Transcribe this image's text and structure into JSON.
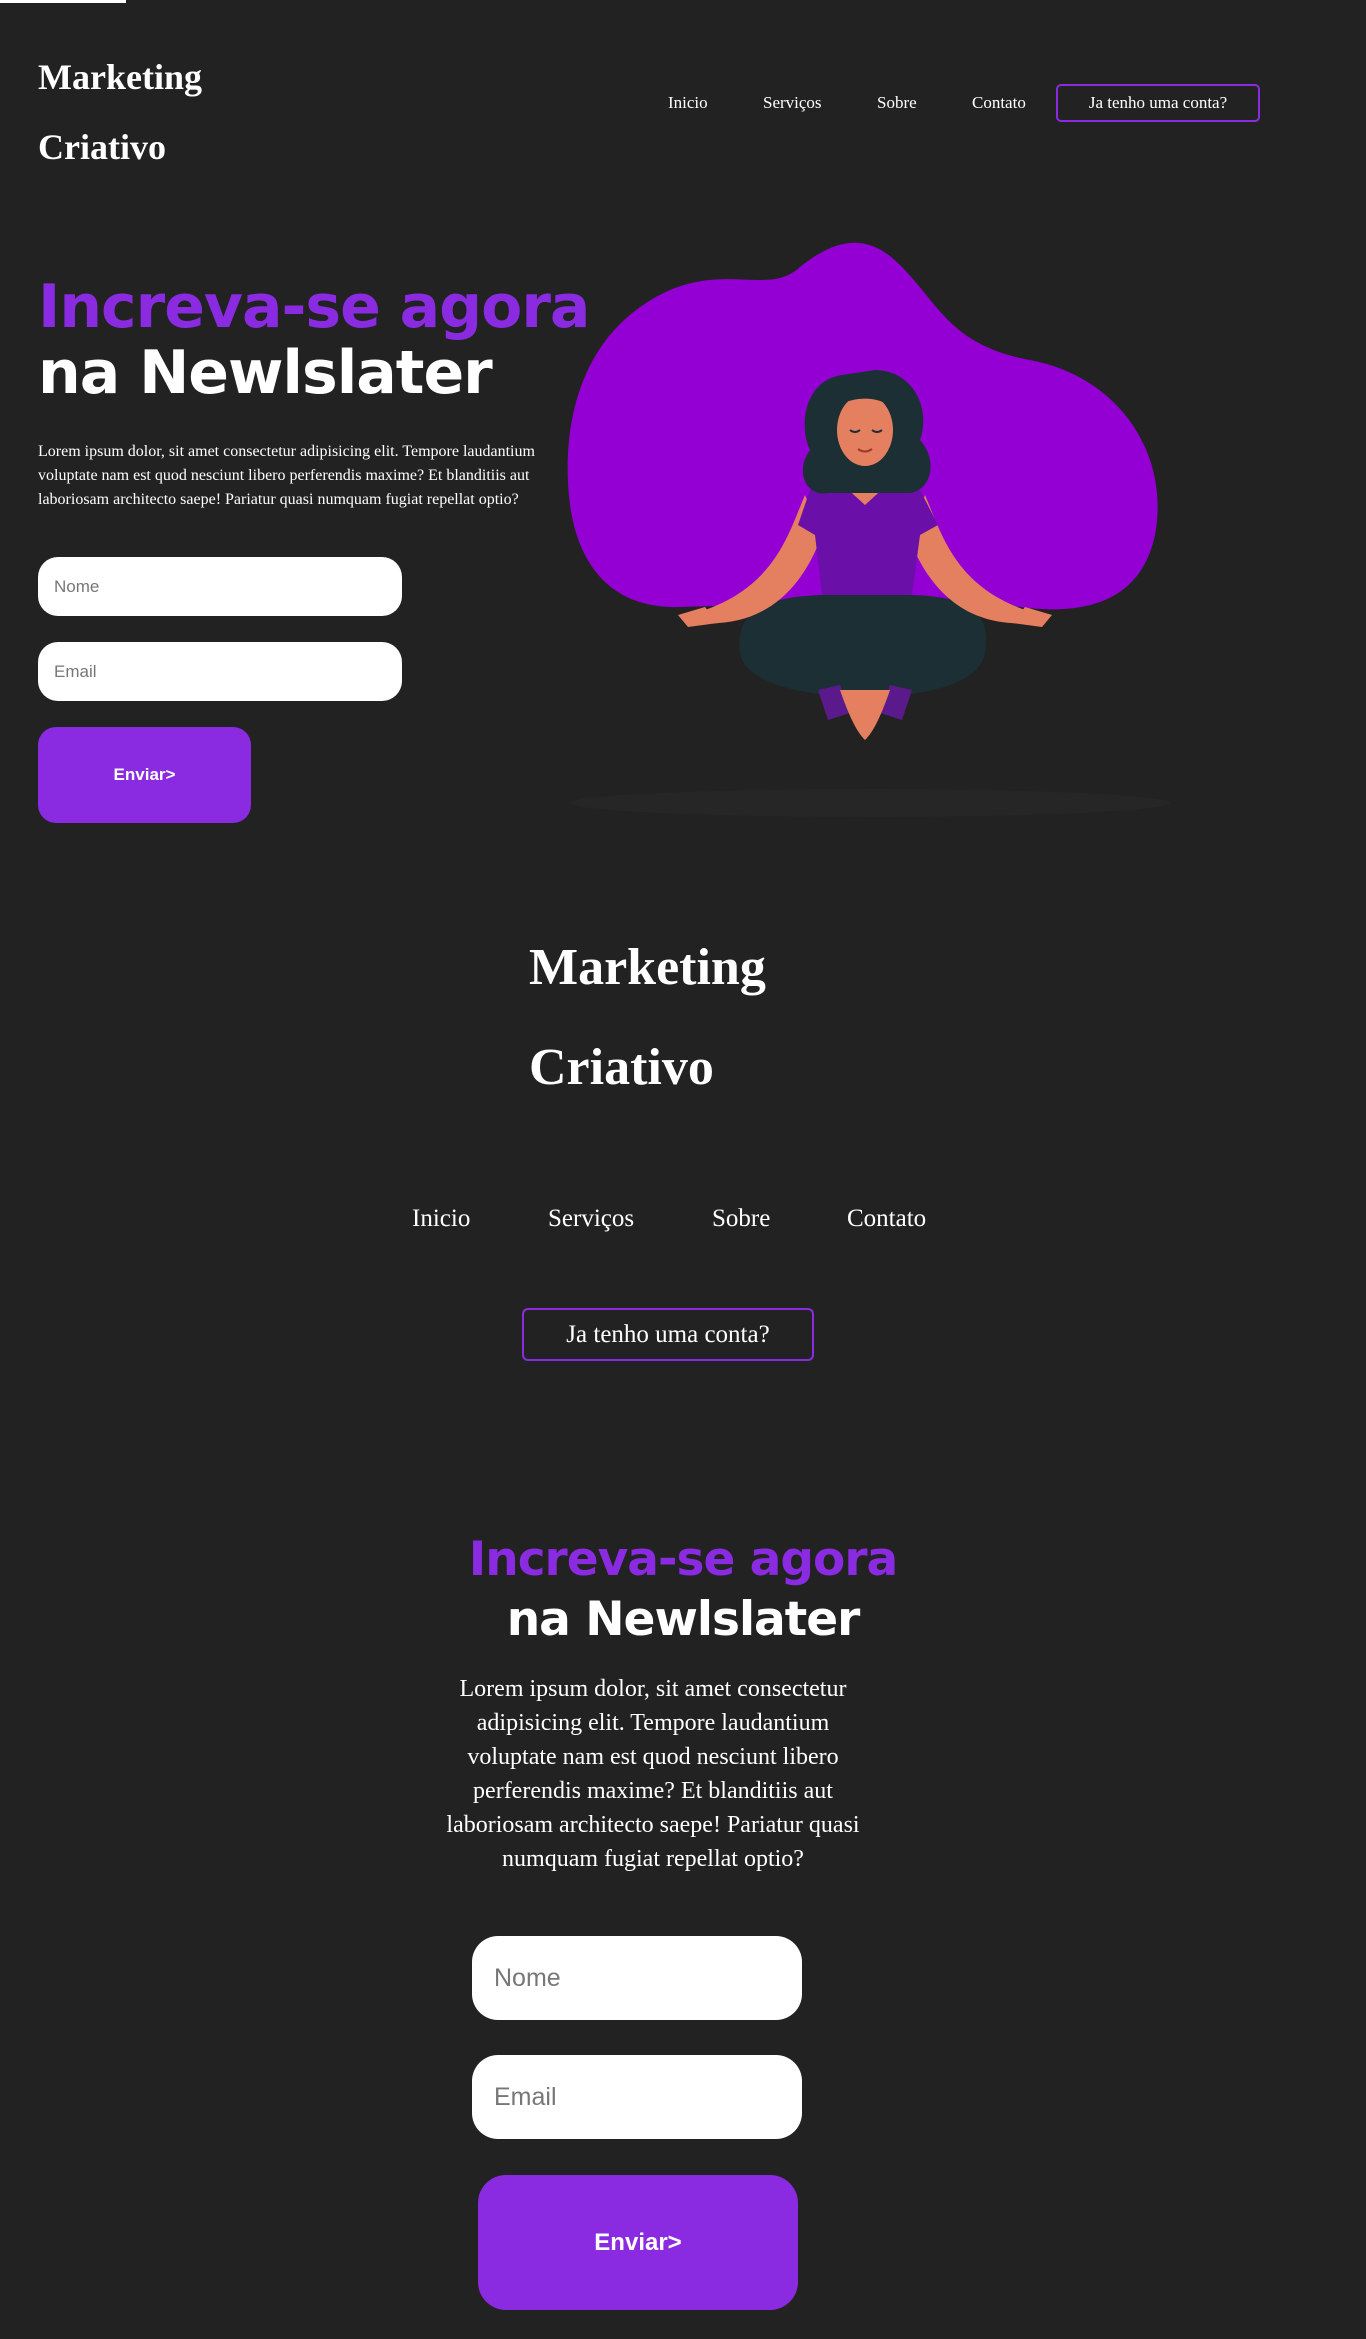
{
  "brand": {
    "line1": "Marketing",
    "line2": "Criativo"
  },
  "nav": {
    "items": [
      "Inicio",
      "Serviços",
      "Sobre",
      "Contato"
    ],
    "account_button": "Ja tenho uma conta?"
  },
  "hero": {
    "title_accent": "Increva-se agora",
    "title_main": "na Newlslater",
    "body": "Lorem ipsum dolor, sit amet consectetur adipisicing elit. Tempore laudantium voluptate nam est quod nesciunt libero perferendis maxime? Et blanditiis aut laboriosam architecto saepe! Pariatur quasi numquam fugiat repellat optio?"
  },
  "form": {
    "name_placeholder": "Nome",
    "email_placeholder": "Email",
    "submit_label": "Enviar>"
  },
  "colors": {
    "background": "#222222",
    "accent": "#8a2be2",
    "blob": "#9400d3",
    "text": "#ffffff"
  },
  "icons": {
    "illustration": "meditating-woman-illustration"
  }
}
